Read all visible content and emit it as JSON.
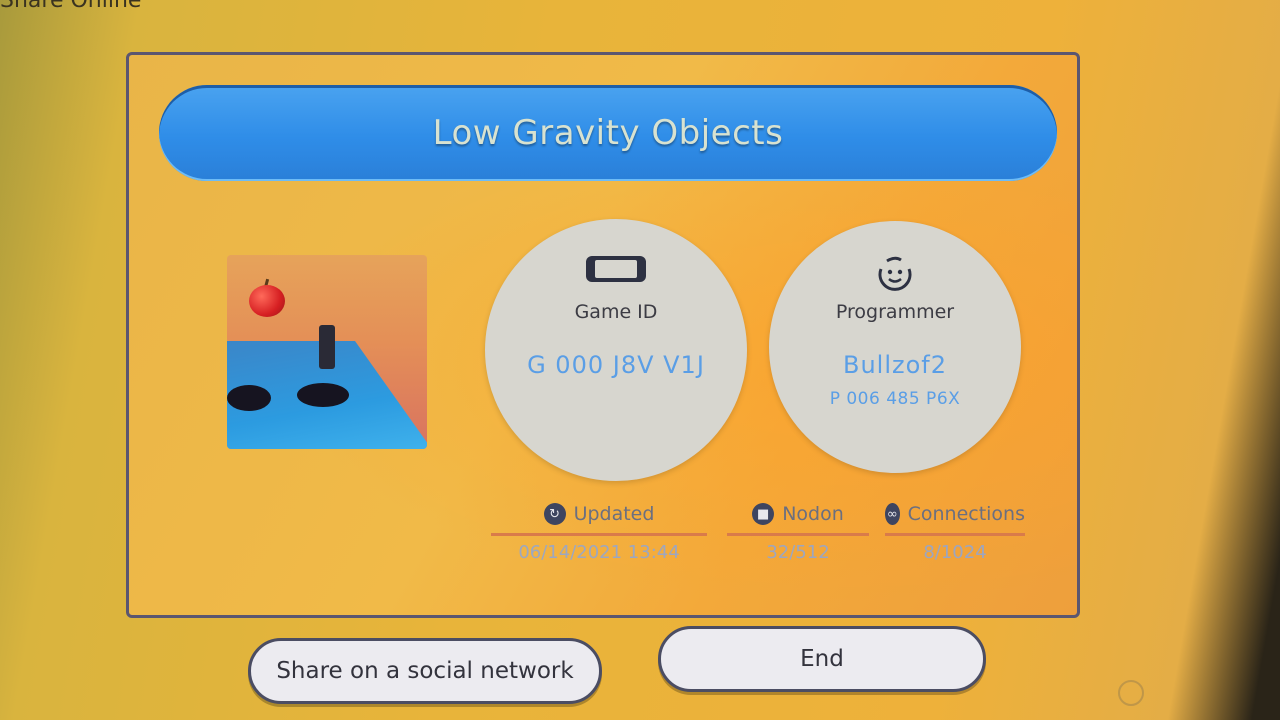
{
  "header": {
    "partial_title": "Share Online"
  },
  "title": "Low Gravity Objects",
  "thumbnail": {
    "alt": "game preview"
  },
  "game_id": {
    "label": "Game ID",
    "value": "G 000 J8V V1J",
    "icon": "console-icon"
  },
  "programmer": {
    "label": "Programmer",
    "name": "Bullzof2",
    "id": "P 006 485 P6X",
    "icon": "face-icon"
  },
  "stats": [
    {
      "label": "Updated",
      "value": "06/14/2021 13:44",
      "icon": "refresh-icon"
    },
    {
      "label": "Nodon",
      "value": "32/512",
      "icon": "nodon-icon"
    },
    {
      "label": "Connections",
      "value": "8/1024",
      "icon": "link-icon"
    }
  ],
  "buttons": {
    "share": "Share on a social network",
    "end": "End"
  },
  "colors": {
    "title_bar": "#2f8de8",
    "panel": "#f1ba48",
    "value_text": "#5a9ee6",
    "rule": "#d97b4a"
  }
}
